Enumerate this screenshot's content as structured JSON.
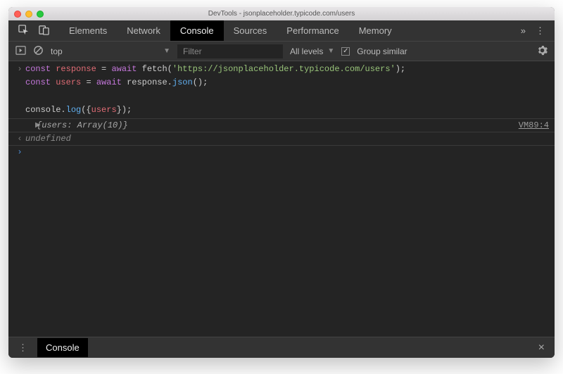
{
  "window": {
    "title": "DevTools - jsonplaceholder.typicode.com/users"
  },
  "tabs": {
    "items": [
      "Elements",
      "Network",
      "Console",
      "Sources",
      "Performance",
      "Memory"
    ],
    "active": "Console",
    "overflow": "»"
  },
  "toolbar": {
    "context": "top",
    "filter_placeholder": "Filter",
    "levels_label": "All levels",
    "group_label": "Group similar"
  },
  "code": {
    "line1": {
      "kw1": "const",
      "var1": "response",
      "op1": "=",
      "kw2": "await",
      "fn1": "fetch",
      "paren1": "(",
      "str": "'https://jsonplaceholder.typicode.com/users'",
      "paren2": ");"
    },
    "line2": {
      "kw1": "const",
      "var1": "users",
      "op1": "=",
      "kw2": "await",
      "obj": "response",
      "dot": ".",
      "fn": "json",
      "paren": "();"
    },
    "line3": {
      "obj": "console",
      "dot": ".",
      "fn": "log",
      "paren1": "({",
      "var": "users",
      "paren2": "});"
    }
  },
  "result": {
    "preview_open": "{",
    "preview_key": "users",
    "preview_colon": ": ",
    "preview_type": "Array(10)",
    "preview_close": "}",
    "source": "VM89:4"
  },
  "return_value": "undefined",
  "drawer": {
    "tab": "Console"
  }
}
